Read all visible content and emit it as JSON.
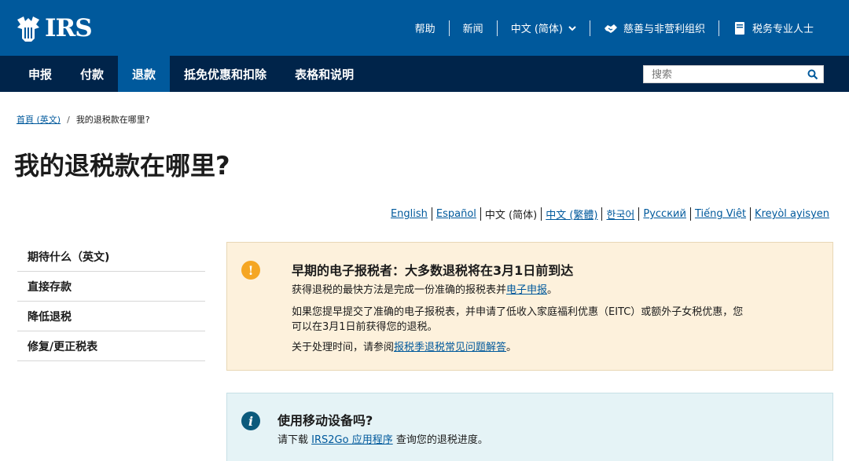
{
  "header": {
    "logo_text": "IRS",
    "utility": {
      "help": "帮助",
      "news": "新闻",
      "language": "中文 (简体)",
      "charities": "慈善与非营利组织",
      "tax_pros": "税务专业人士"
    }
  },
  "nav": {
    "tabs": [
      {
        "label": "申报"
      },
      {
        "label": "付款"
      },
      {
        "label": "退款"
      },
      {
        "label": "抵免优惠和扣除"
      },
      {
        "label": "表格和说明"
      }
    ],
    "active_tab": "退款",
    "search_placeholder": "搜索"
  },
  "breadcrumb": {
    "home": "首頁 (英文)",
    "separator": "/",
    "current": "我的退税款在哪里?"
  },
  "page_title": "我的退税款在哪里?",
  "languages": [
    {
      "label": "English"
    },
    {
      "label": "Español"
    },
    {
      "label": "中文 (简体)"
    },
    {
      "label": "中文 (繁體)"
    },
    {
      "label": "한국어"
    },
    {
      "label": "Русский"
    },
    {
      "label": "Tiếng Việt"
    },
    {
      "label": "Kreyòl ayisyen"
    }
  ],
  "current_language": "中文 (简体)",
  "sidebar": {
    "items": [
      {
        "label": "期待什么（英文)"
      },
      {
        "label": "直接存款"
      },
      {
        "label": "降低退税"
      },
      {
        "label": "修复/更正税表"
      }
    ]
  },
  "alert_warning": {
    "heading": "早期的电子报税者：大多数退税将在3月1日前到达",
    "p1_text": "获得退税的最快方法是完成一份准确的报税表并",
    "p1_link": "电子申报",
    "p1_end": "。",
    "p2_text": "如果您提早提交了准确的电子报税表，并申请了低收入家庭福利优惠（EITC）或额外子女税优惠，您可以在3月1日前获得您的退税。",
    "p3_text": "关于处理时间，请参阅",
    "p3_link": "报税季退税常见问题解答",
    "p3_end": "。",
    "icon_color": "#f5a623",
    "background": "#fdf1dc"
  },
  "alert_info": {
    "heading": "使用移动设备吗?",
    "p_text": "请下载 ",
    "p_link": "IRS2Go 应用程序",
    "p_end": " 查询您的退税进度。",
    "icon_color": "#0c5a7c",
    "background": "#e5f3f6"
  },
  "colors": {
    "header_blue": "#00599c",
    "nav_navy": "#00244a",
    "link": "#00599c"
  }
}
